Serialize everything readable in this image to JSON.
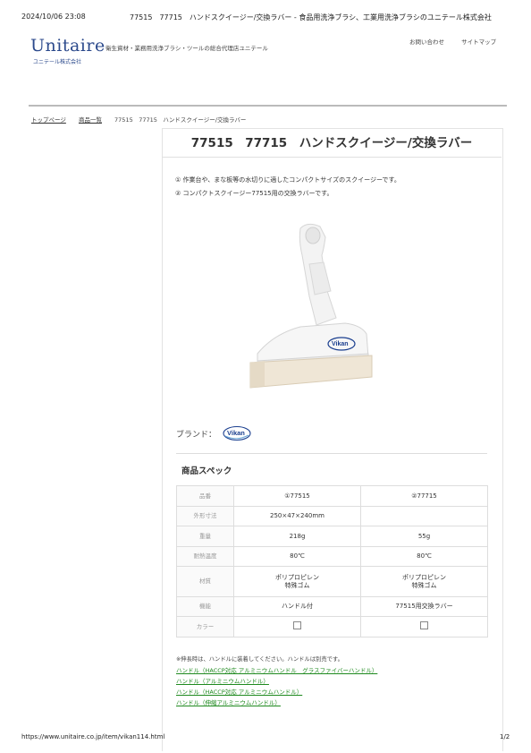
{
  "print_header": {
    "datetime": "2024/10/06 23:08",
    "title": "77515　77715　ハンドスクイージー/交換ラバー - 食品用洗浄ブラシ、工業用洗浄ブラシのユニテール株式会社"
  },
  "header": {
    "logo": "Unitaire",
    "logo_sub": "ユニテール株式会社",
    "tagline": "衛生資材・業務用洗浄ブラシ・ツールの総合代理店ユニテール",
    "links": [
      "お問い合わせ",
      "サイトマップ"
    ]
  },
  "breadcrumb": [
    "トップページ",
    "商品一覧",
    "77515　77715　ハンドスクイージー/交換ラバー"
  ],
  "product": {
    "title": "77515　77715　ハンドスクイージー/交換ラバー",
    "desc1": "① 作業台や、まな板等の水切りに適したコンパクトサイズのスクイージーです。",
    "desc2": "② コンパクトスクイージー77515用の交換ラバーです。",
    "image_brand_text": "Vikan",
    "brand_label": "ブランド：",
    "brand_name": "Vikan"
  },
  "spec": {
    "title": "商品スペック",
    "rows": [
      {
        "label": "品番",
        "v1": "①77515",
        "v2": "②77715"
      },
      {
        "label": "外形寸法",
        "v1": "250×47×240mm",
        "v2": ""
      },
      {
        "label": "重量",
        "v1": "218g",
        "v2": "55g"
      },
      {
        "label": "耐熱温度",
        "v1": "80℃",
        "v2": "80℃"
      },
      {
        "label": "材質",
        "v1a": "ポリプロピレン",
        "v1b": "特殊ゴム",
        "v2a": "ポリプロピレン",
        "v2b": "特殊ゴム"
      },
      {
        "label": "機能",
        "v1": "ハンドル付",
        "v2": "77515用交換ラバー"
      },
      {
        "label": "カラー",
        "v1": "",
        "v2": ""
      }
    ]
  },
  "note": "※伸長時は、ハンドルに装着してください。ハンドルは別売です。",
  "links": [
    "ハンドル（HACCP対応 アルミニウムハンドル　グラスファイバーハンドル）",
    "ハンドル（アルミニウムハンドル）",
    "ハンドル（HACCP対応 アルミニウムハンドル）",
    "ハンドル（伸縮アルミニウムハンドル）"
  ],
  "footer": {
    "url": "https://www.unitaire.co.jp/item/vikan114.html",
    "page": "1/2"
  },
  "colors": {
    "link": "#1f8a1f",
    "logo": "#2c4a8c",
    "brand_blue": "#1b3f8f"
  }
}
